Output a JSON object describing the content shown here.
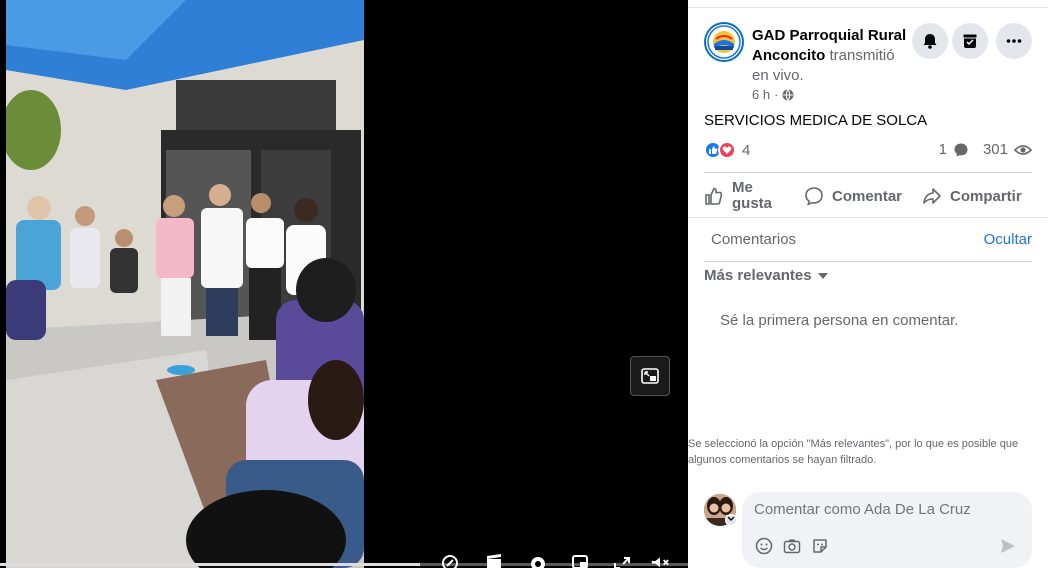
{
  "header": {
    "page_name": "GAD Parroquial Rural Anconcito",
    "action_text": "transmitió en vivo.",
    "time": "6 h",
    "dot": "·"
  },
  "post": {
    "text": "SERVICIOS MEDICA DE SOLCA"
  },
  "reactions": {
    "count": "4",
    "comments_count": "1",
    "views_count": "301"
  },
  "actions": {
    "like": "Me gusta",
    "comment": "Comentar",
    "share": "Compartir"
  },
  "comments": {
    "tab_label": "Comentarios",
    "hide_label": "Ocultar",
    "sort_label": "Más relevantes",
    "empty_text": "Sé la primera persona en comentar.",
    "filter_note": "Se seleccionó la opción \"Más relevantes\", por lo que es posible que algunos comentarios se hayan filtrado.",
    "composer_placeholder": "Comentar como Ada De La Cruz"
  },
  "video": {
    "progress": 0.61
  },
  "icons": {
    "bell": "bell-icon",
    "save": "save-icon",
    "more": "more-icon",
    "globe": "globe-icon",
    "like": "like-icon",
    "love": "love-icon",
    "comment_bubble": "comment-icon",
    "eye": "eye-icon",
    "share": "share-icon",
    "caret": "caret-down-icon",
    "emoji": "emoji-icon",
    "camera": "camera-icon",
    "sticker": "sticker-icon",
    "send": "send-icon",
    "pip": "pip-icon"
  },
  "colors": {
    "accent": "#1b74e4",
    "like_blue": "#1877f2",
    "love_red": "#f33e58",
    "text": "#050505",
    "secondary": "#65676b"
  }
}
